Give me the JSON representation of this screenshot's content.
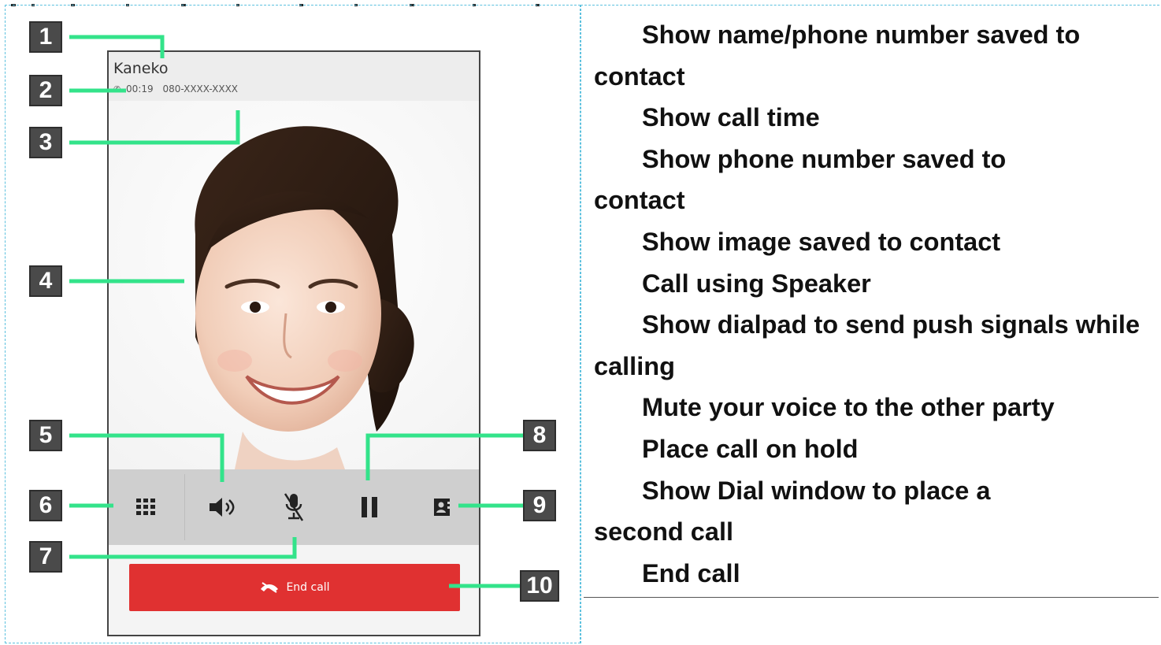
{
  "screen": {
    "contact_name": "Kaneko",
    "call_time": "00:19",
    "phone_number": "080-XXXX-XXXX",
    "end_call_label": "End call",
    "colors": {
      "accent_green": "#33e38a",
      "end_call_red": "#e03131",
      "marker_gray": "#4a4a4a"
    },
    "controls": [
      {
        "name": "dialpad",
        "icon": "dialpad-icon"
      },
      {
        "name": "speaker",
        "icon": "speaker-icon"
      },
      {
        "name": "mute",
        "icon": "mic-muted-icon"
      },
      {
        "name": "hold",
        "icon": "pause-icon"
      },
      {
        "name": "add-call",
        "icon": "contact-book-icon"
      }
    ]
  },
  "markers": [
    "1",
    "2",
    "3",
    "4",
    "5",
    "6",
    "7",
    "8",
    "9",
    "10"
  ],
  "legend": [
    "Show name/phone number saved to contact",
    "Show call time",
    "Show phone number saved to contact",
    "Show image saved to contact",
    "Call using Speaker",
    "Show dialpad to send push signals while calling",
    "Mute your voice to the other party",
    "Place call on hold",
    "Show Dial window to place a second call",
    "End call"
  ]
}
